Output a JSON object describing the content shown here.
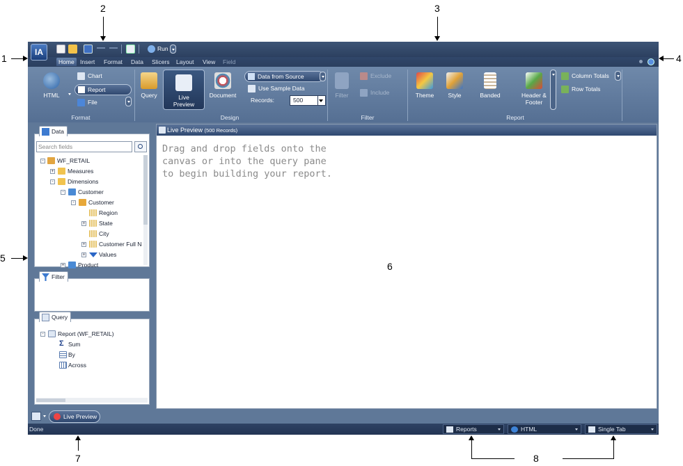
{
  "callouts": {
    "c1": "1",
    "c2": "2",
    "c3": "3",
    "c4": "4",
    "c5": "5",
    "c6": "6",
    "c7": "7",
    "c8": "8"
  },
  "titlebar": {
    "logo": "IA",
    "run_label": "Run"
  },
  "menubar": {
    "items": [
      "Home",
      "Insert",
      "Format",
      "Data",
      "Slicers",
      "Layout",
      "View",
      "Field"
    ]
  },
  "ribbon": {
    "format": {
      "html": "HTML",
      "chart": "Chart",
      "report": "Report",
      "file": "File",
      "label": "Format"
    },
    "design": {
      "query": "Query",
      "live_preview": "Live Preview",
      "document": "Document",
      "data_from_source": "Data from Source",
      "use_sample_data": "Use Sample Data",
      "records_label": "Records:",
      "records_value": "500",
      "label": "Design"
    },
    "filter": {
      "filter": "Filter",
      "exclude": "Exclude",
      "include": "Include",
      "label": "Filter"
    },
    "report": {
      "theme": "Theme",
      "style": "Style",
      "banded": "Banded",
      "header_footer": "Header & Footer",
      "column_totals": "Column Totals",
      "row_totals": "Row Totals",
      "label": "Report"
    }
  },
  "data_panel": {
    "tab": "Data",
    "search_placeholder": "Search fields",
    "tree": [
      "WF_RETAIL",
      "Measures",
      "Dimensions",
      "Customer",
      "Customer",
      "Region",
      "State",
      "City",
      "Customer Full Na",
      "Values",
      "Product"
    ]
  },
  "filter_panel": {
    "tab": "Filter"
  },
  "query_panel": {
    "tab": "Query",
    "tree": [
      "Report (WF_RETAIL)",
      "Sum",
      "By",
      "Across"
    ]
  },
  "canvas": {
    "title": "Live Preview",
    "records": "(500 Records)",
    "hint": "Drag and drop fields onto the canvas or into the query pane to begin building your report."
  },
  "bottom_tab": {
    "label": "Live Preview"
  },
  "status": {
    "text": "Done",
    "reports": "Reports",
    "html": "HTML",
    "tab": "Single Tab"
  },
  "colors": {
    "frame": "#5f7898",
    "ribbon": "#6f89aa",
    "menubar": "#2b3f5f",
    "accent": "#2f4870"
  }
}
